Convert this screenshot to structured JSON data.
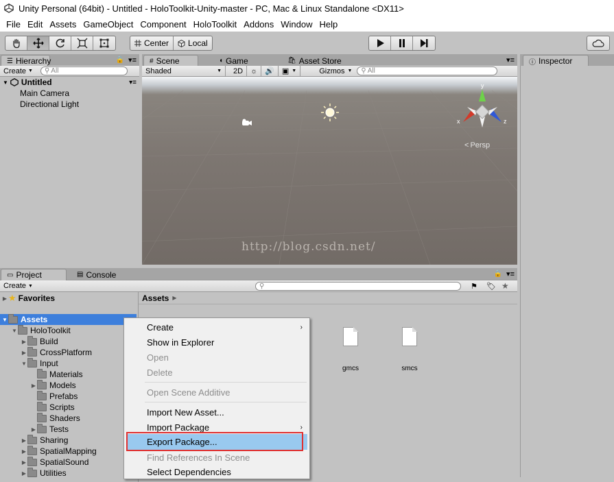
{
  "window": {
    "title": "Unity Personal (64bit) - Untitled - HoloToolkit-Unity-master - PC, Mac & Linux Standalone <DX11>"
  },
  "menu": [
    "File",
    "Edit",
    "Assets",
    "GameObject",
    "Component",
    "HoloToolkit",
    "Addons",
    "Window",
    "Help"
  ],
  "toolbar": {
    "pivot_label": "Center",
    "space_label": "Local"
  },
  "hierarchy": {
    "tab_label": "Hierarchy",
    "create_label": "Create",
    "search_placeholder": "All",
    "scene_name": "Untitled",
    "items": [
      "Main Camera",
      "Directional Light"
    ]
  },
  "scene": {
    "tabs": [
      "Scene",
      "Game",
      "Asset Store"
    ],
    "shading_mode": "Shaded",
    "mode_2d": "2D",
    "gizmos_label": "Gizmos",
    "search_placeholder": "All",
    "persp_label": "Persp",
    "axis_x": "x",
    "axis_y": "y",
    "axis_z": "z",
    "watermark": "http://blog.csdn.net/"
  },
  "inspector": {
    "tab_label": "Inspector"
  },
  "project": {
    "tabs": [
      "Project",
      "Console"
    ],
    "create_label": "Create",
    "favorites_label": "Favorites",
    "breadcrumb": "Assets",
    "tree": [
      {
        "label": "Assets",
        "selected": true
      },
      {
        "label": "HoloToolkit"
      },
      {
        "label": "Build"
      },
      {
        "label": "CrossPlatform"
      },
      {
        "label": "Input"
      },
      {
        "label": "Materials"
      },
      {
        "label": "Models"
      },
      {
        "label": "Prefabs"
      },
      {
        "label": "Scripts"
      },
      {
        "label": "Shaders"
      },
      {
        "label": "Tests"
      },
      {
        "label": "Sharing"
      },
      {
        "label": "SpatialMapping"
      },
      {
        "label": "SpatialSound"
      },
      {
        "label": "Utilities"
      }
    ],
    "files": [
      "gmcs",
      "smcs"
    ]
  },
  "context_menu": {
    "items": [
      {
        "label": "Create",
        "enabled": true,
        "submenu": true
      },
      {
        "label": "Show in Explorer",
        "enabled": true
      },
      {
        "label": "Open",
        "enabled": false
      },
      {
        "label": "Delete",
        "enabled": false
      },
      {
        "label": "Open Scene Additive",
        "enabled": false
      },
      {
        "label": "Import New Asset...",
        "enabled": true
      },
      {
        "label": "Import Package",
        "enabled": true,
        "submenu": true
      },
      {
        "label": "Export Package...",
        "enabled": true,
        "highlighted": true
      },
      {
        "label": "Find References In Scene",
        "enabled": false
      },
      {
        "label": "Select Dependencies",
        "enabled": true
      }
    ],
    "highlight_color": "#99c9ef",
    "callout_color": "#e03030"
  },
  "colors": {
    "selection": "#3d7fdc",
    "panel": "#c2c2c2"
  }
}
